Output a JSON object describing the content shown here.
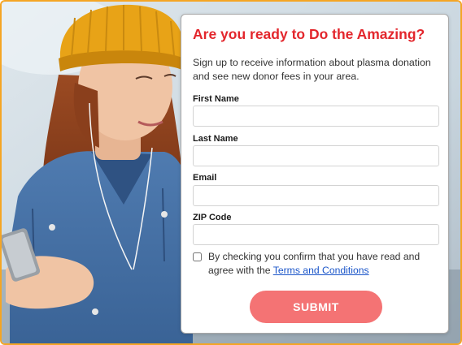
{
  "colors": {
    "frame_border": "#f5a524",
    "title_red": "#e3262c",
    "button_coral": "#f47374",
    "link_blue": "#1a55c9"
  },
  "hero_image": {
    "icon": "woman-with-yellow-beanie-photo"
  },
  "form": {
    "title": "Are you ready to Do the Amazing?",
    "subtitle": "Sign up to receive information about plasma donation and see new donor fees in your area.",
    "fields": [
      {
        "label": "First Name",
        "value": ""
      },
      {
        "label": "Last Name",
        "value": ""
      },
      {
        "label": "Email",
        "value": ""
      },
      {
        "label": "ZIP Code",
        "value": ""
      }
    ],
    "consent": {
      "checked": false,
      "text_before": "By checking you confirm that you have read and agree with the ",
      "link_text": "Terms and Conditions"
    },
    "submit_label": "SUBMIT"
  }
}
